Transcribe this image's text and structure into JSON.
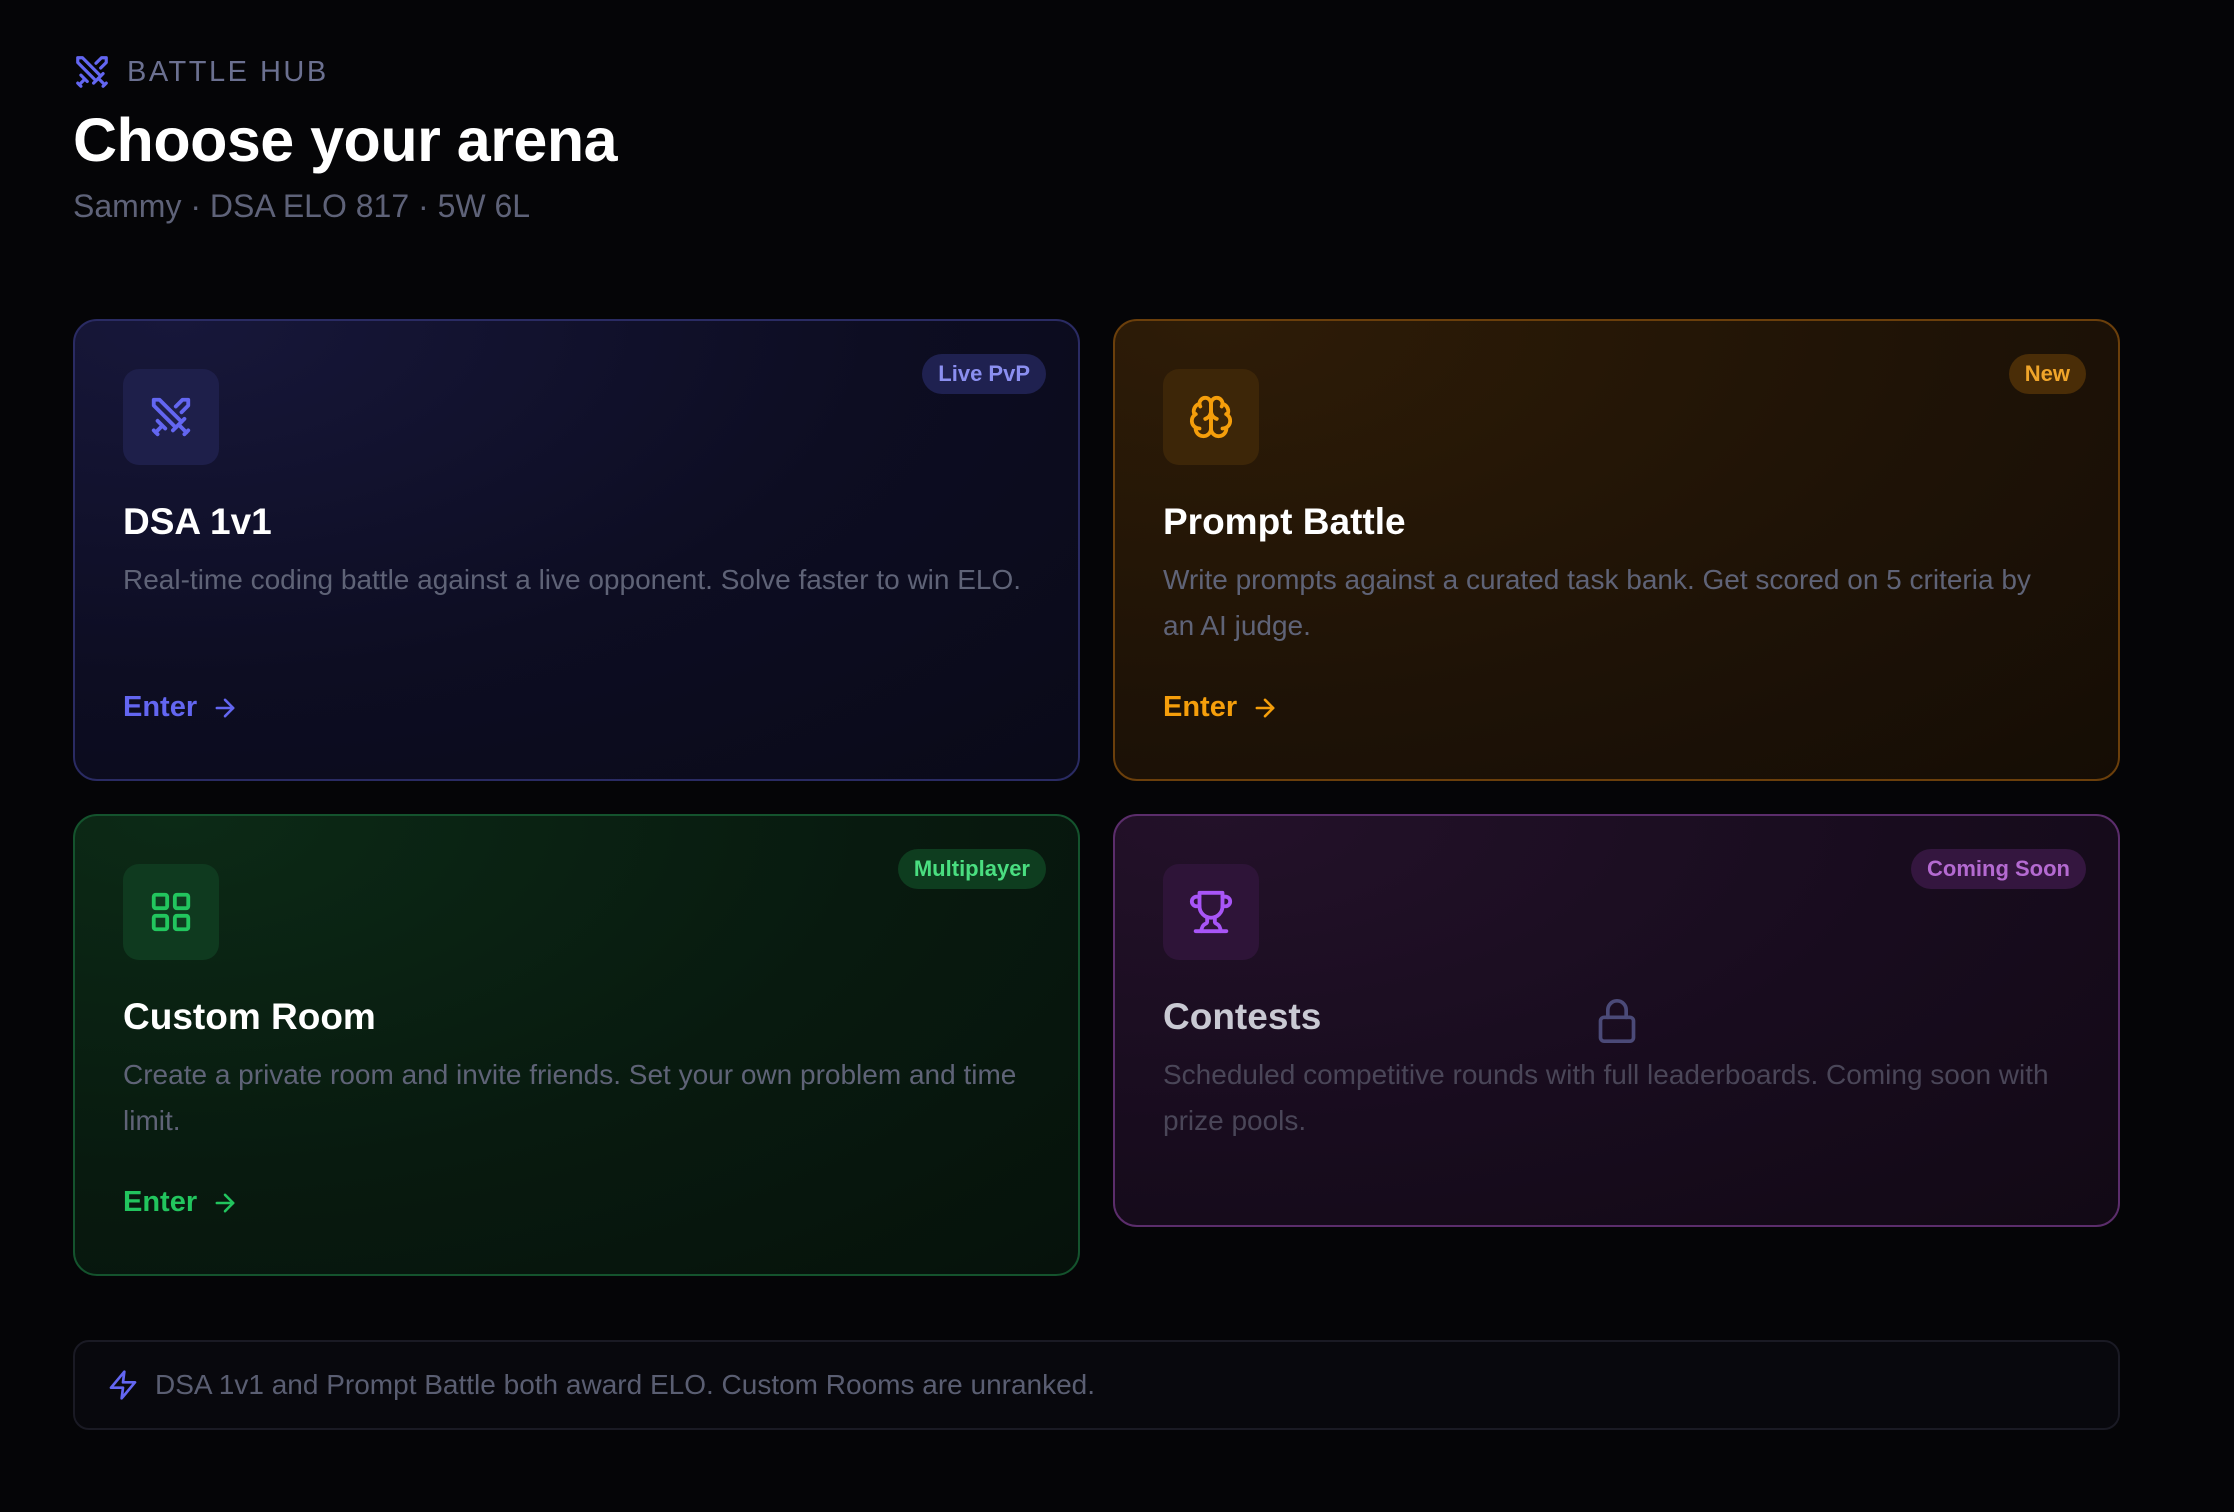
{
  "header": {
    "eyebrow": "BATTLE HUB",
    "eyebrow_icon": "crossed-swords-icon",
    "title": "Choose your arena",
    "subtitle": "Sammy · DSA ELO 817 · 5W 6L"
  },
  "cards": [
    {
      "id": "dsa",
      "icon": "crossed-swords-icon",
      "badge": "Live PvP",
      "title": "DSA 1v1",
      "description": "Real-time coding battle against a live opponent. Solve faster to win ELO.",
      "action": "Enter",
      "accent": "#6366f1"
    },
    {
      "id": "prompt",
      "icon": "brain-icon",
      "badge": "New",
      "title": "Prompt Battle",
      "description": "Write prompts against a curated task bank. Get scored on 5 criteria by an AI judge.",
      "action": "Enter",
      "accent": "#f59e0b"
    },
    {
      "id": "custom",
      "icon": "grid-icon",
      "badge": "Multiplayer",
      "title": "Custom Room",
      "description": "Create a private room and invite friends. Set your own problem and time limit.",
      "action": "Enter",
      "accent": "#22c55e"
    },
    {
      "id": "contests",
      "icon": "trophy-icon",
      "badge": "Coming Soon",
      "title": "Contests",
      "description": "Scheduled competitive rounds with full leaderboards. Coming soon with prize pools.",
      "status_icon": "lock-icon",
      "accent": "#a855f7"
    }
  ],
  "footer": {
    "icon": "lightning-icon",
    "text": "DSA 1v1 and Prompt Battle both award ELO. Custom Rooms are unranked."
  }
}
